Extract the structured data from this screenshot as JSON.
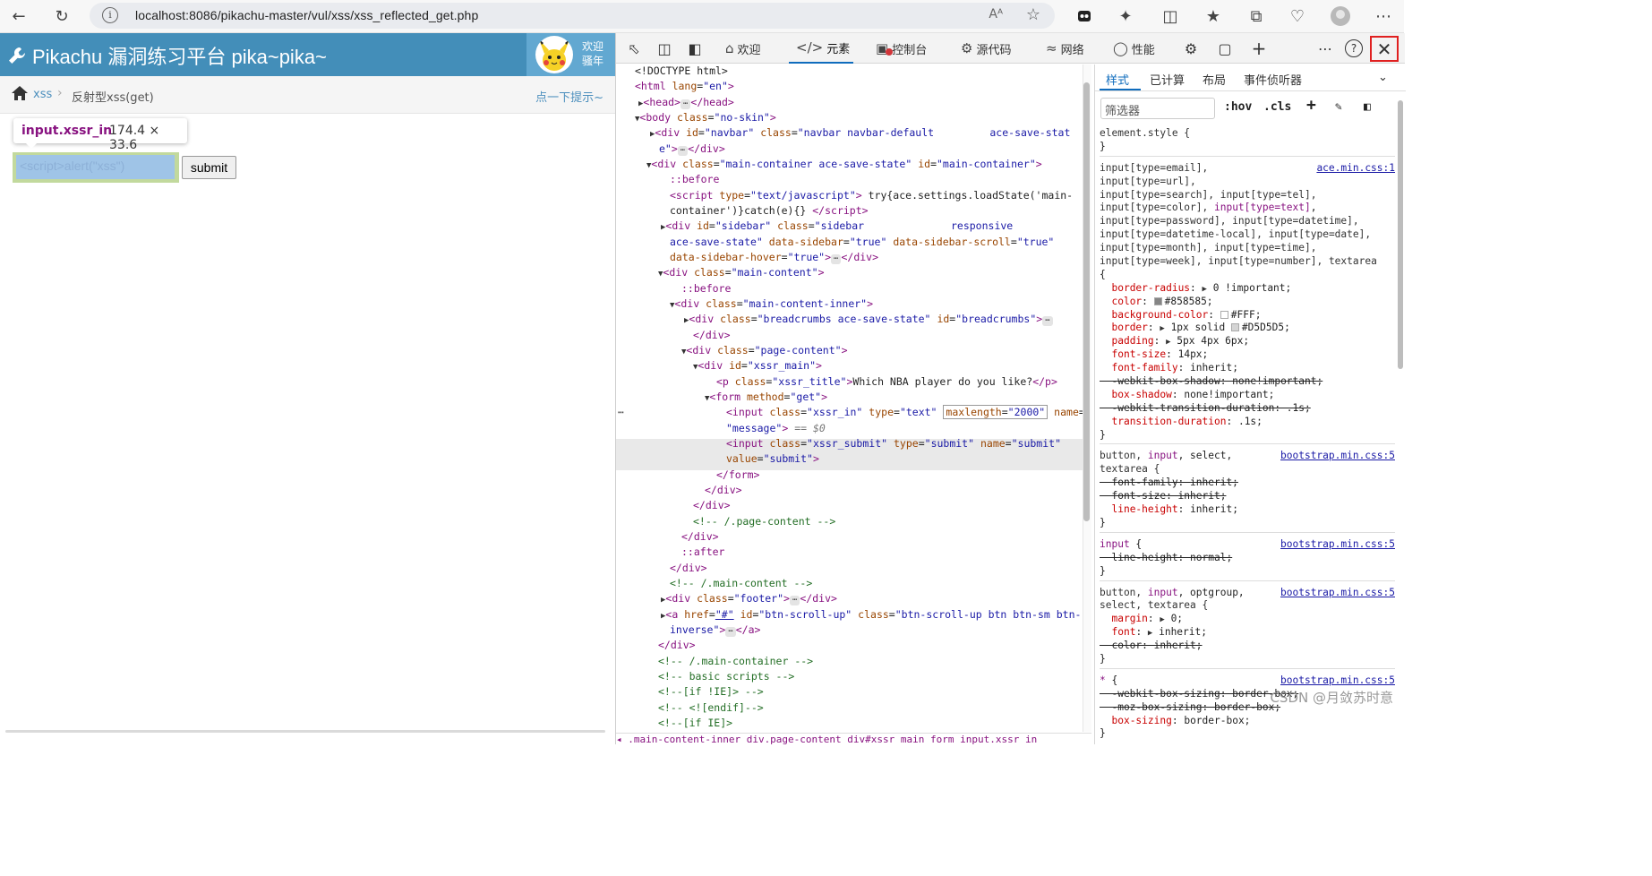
{
  "browser": {
    "url": "localhost:8086/pikachu-master/vul/xss/xss_reflected_get.php",
    "reader_mode_label": "Aᴬ"
  },
  "page": {
    "brand": "Pikachu 漏洞练习平台 pika~pika~",
    "welcome_line1": "欢迎",
    "welcome_line2": "骚年",
    "breadcrumb_xss": "xss",
    "breadcrumb_current": "反射型xss(get)",
    "hint_link": "点一下提示~",
    "tooltip_selector": "input.xssr_in",
    "tooltip_dims": "174.4 × 33.6",
    "input_value": "<script>alert(\"xss\")",
    "submit_label": "submit"
  },
  "devtools": {
    "tabs": {
      "welcome": "欢迎",
      "elements": "元素",
      "console": "控制台",
      "sources": "源代码",
      "network": "网络",
      "performance": "性能"
    },
    "styles_tabs": {
      "styles": "样式",
      "computed": "已计算",
      "layout": "布局",
      "listeners": "事件侦听器"
    },
    "filter_placeholder": "筛选器",
    "hov": ":hov",
    "cls": ".cls",
    "breadcrumbs": "◂ .main-content-inner   div.page-content   div#xssr_main   form   input.xssr_in"
  },
  "colors": {
    "navbar": "#438eb9",
    "user_panel": "#62a8d1",
    "tag": "#881280",
    "attr_name": "#994500",
    "attr_value": "#1a1aa6",
    "comment": "#236e25",
    "active_blue": "#0f6cbd",
    "close_highlight": "#e02020"
  },
  "watermark": "CSDN @月敛苏时意"
}
